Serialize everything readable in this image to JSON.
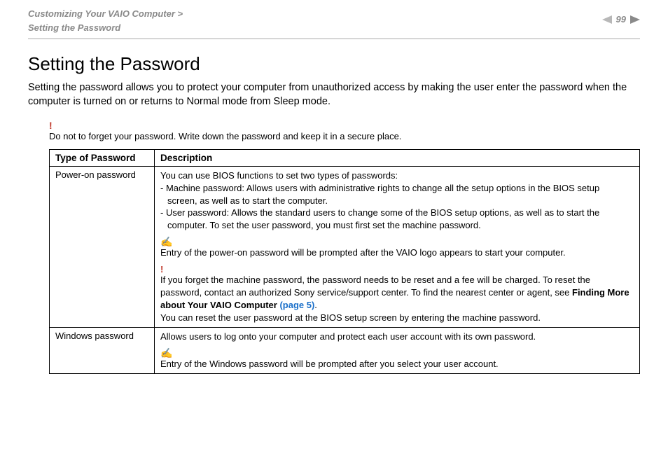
{
  "header": {
    "breadcrumb_line1": "Customizing Your VAIO Computer >",
    "breadcrumb_line2": "Setting the Password",
    "page_number": "99"
  },
  "title": "Setting the Password",
  "intro": "Setting the password allows you to protect your computer from unauthorized access by making the user enter the password when the computer is turned on or returns to Normal mode from Sleep mode.",
  "top_notice": {
    "icon": "!",
    "text": "Do not to forget your password. Write down the password and keep it in a secure place."
  },
  "table": {
    "headers": {
      "col1": "Type of Password",
      "col2": "Description"
    },
    "rows": [
      {
        "type": "Power-on password",
        "desc_intro": "You can use BIOS functions to set two types of passwords:",
        "bullet1_a": "- Machine password: Allows users with administrative rights to change all the setup options in the BIOS setup",
        "bullet1_b": "screen, as well as to start the computer.",
        "bullet2_a": "- User password: Allows the standard users to change some of the BIOS setup options, as well as to start the",
        "bullet2_b": "computer. To set the user password, you must first set the machine password.",
        "note_icon": "✍",
        "note_text": "Entry of the power-on password will be prompted after the VAIO logo appears to start your computer.",
        "warn_icon": "!",
        "warn_text_a": "If you forget the machine password, the password needs to be reset and a fee will be charged. To reset the password, contact an authorized Sony service/support center. To find the nearest center or agent, see ",
        "warn_bold": "Finding More about Your VAIO Computer ",
        "warn_link": "(page 5)",
        "warn_period": ".",
        "warn_text_b": "You can reset the user password at the BIOS setup screen by entering the machine password."
      },
      {
        "type": "Windows password",
        "desc_intro": "Allows users to log onto your computer and protect each user account with its own password.",
        "note_icon": "✍",
        "note_text": "Entry of the Windows password will be prompted after you select your user account."
      }
    ]
  }
}
